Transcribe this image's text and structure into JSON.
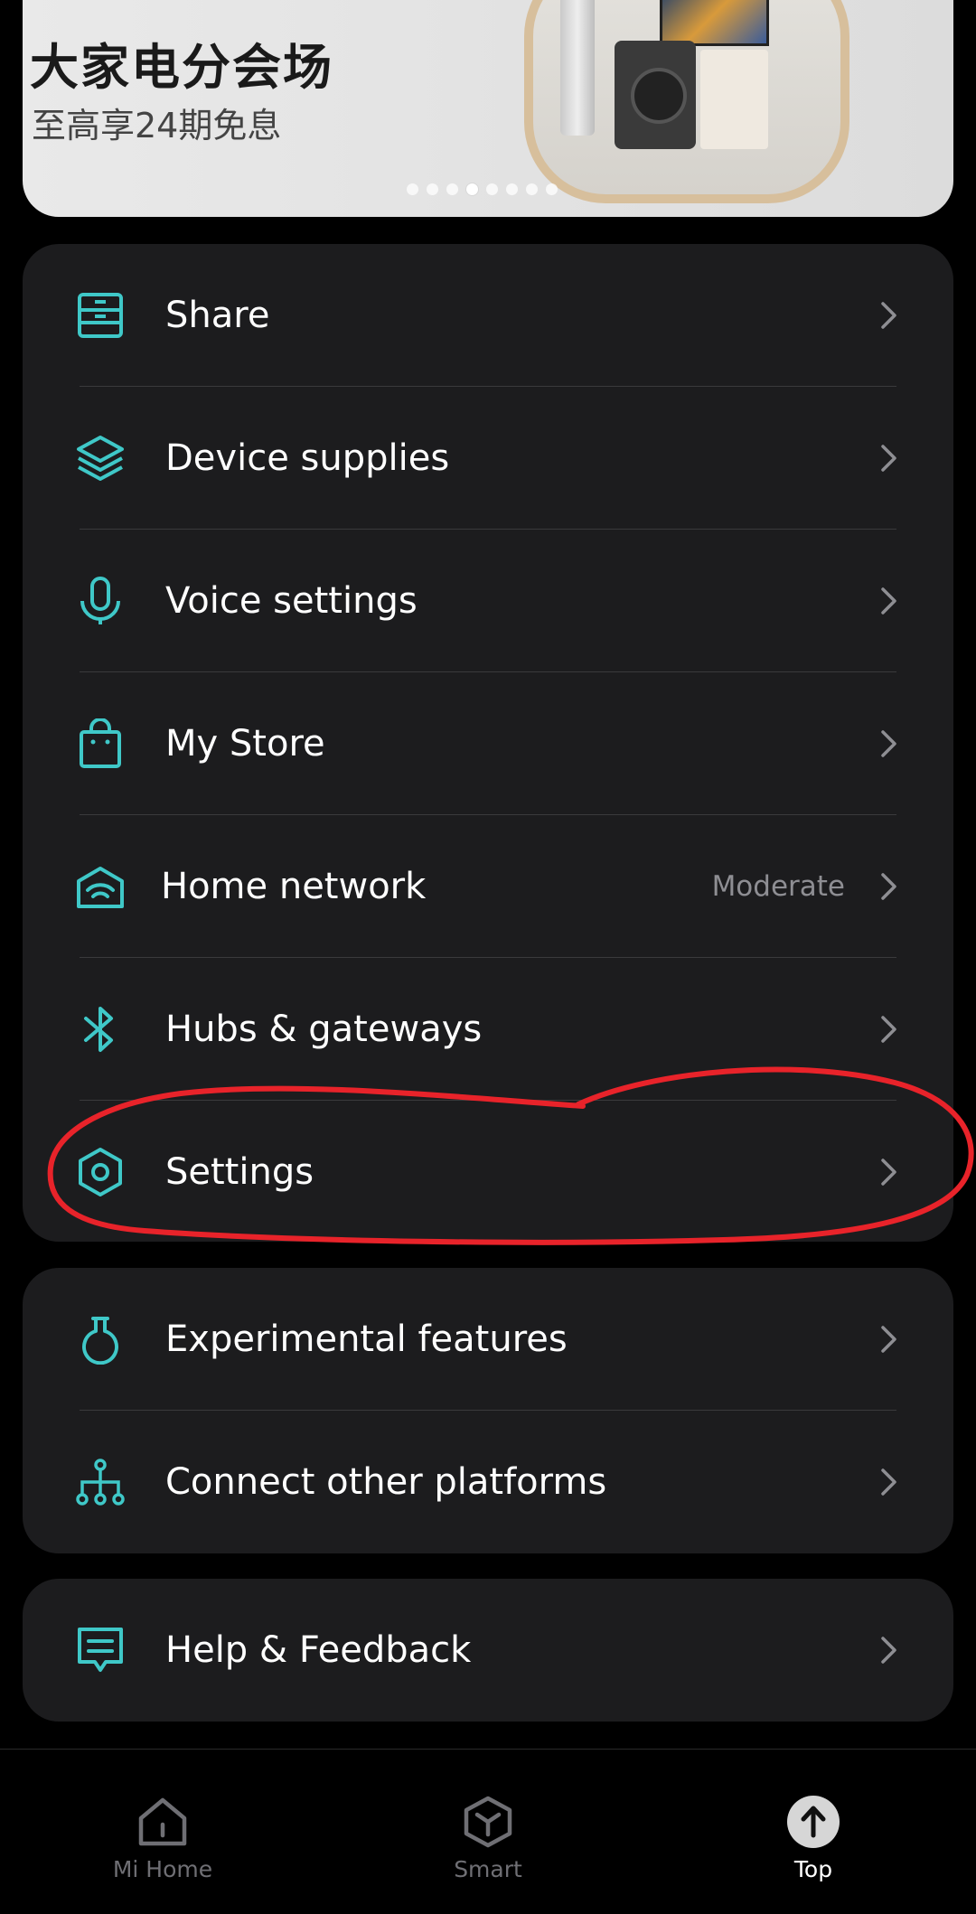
{
  "banner": {
    "title": "大家电分会场",
    "subtitle": "至高享24期免息",
    "dots_total": 8,
    "active_dot": 4
  },
  "menu_group_1": [
    {
      "id": "share",
      "label": "Share",
      "icon": "cabinet-icon"
    },
    {
      "id": "device-supplies",
      "label": "Device supplies",
      "icon": "layers-icon"
    },
    {
      "id": "voice-settings",
      "label": "Voice settings",
      "icon": "microphone-icon"
    },
    {
      "id": "my-store",
      "label": "My Store",
      "icon": "shopping-bag-icon"
    },
    {
      "id": "home-network",
      "label": "Home network",
      "icon": "wifi-router-icon",
      "value": "Moderate"
    },
    {
      "id": "hubs-gateways",
      "label": "Hubs & gateways",
      "icon": "bluetooth-icon"
    },
    {
      "id": "settings",
      "label": "Settings",
      "icon": "hexagon-settings-icon"
    }
  ],
  "menu_group_2": [
    {
      "id": "experimental-features",
      "label": "Experimental features",
      "icon": "flask-icon"
    },
    {
      "id": "connect-other-platforms",
      "label": "Connect other platforms",
      "icon": "network-nodes-icon"
    }
  ],
  "menu_group_3": [
    {
      "id": "help-feedback",
      "label": "Help & Feedback",
      "icon": "message-icon"
    }
  ],
  "bottom_nav": [
    {
      "id": "mi-home",
      "label": "Mi Home",
      "icon": "house-icon"
    },
    {
      "id": "smart",
      "label": "Smart",
      "icon": "cube-icon"
    },
    {
      "id": "top",
      "label": "Top",
      "icon": "arrow-up-circle-icon",
      "active": true
    }
  ],
  "colors": {
    "accent": "#3fc8c8",
    "card_bg": "#1c1c1e",
    "annotation": "#e8232a",
    "secondary_text": "#8e8e93"
  }
}
